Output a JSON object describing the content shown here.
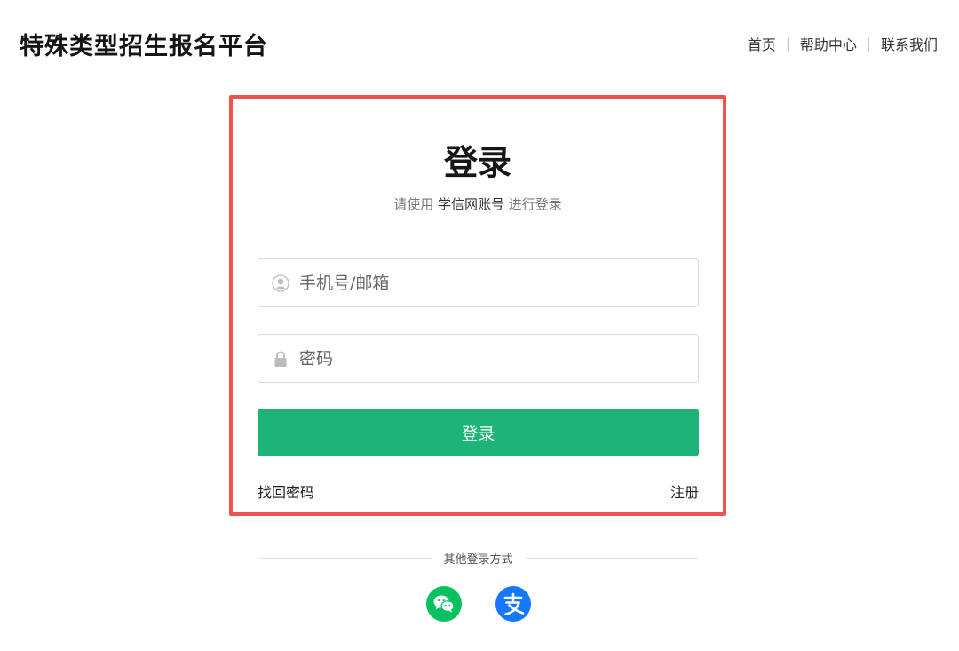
{
  "header": {
    "title": "特殊类型招生报名平台",
    "nav": [
      {
        "label": "首页"
      },
      {
        "label": "帮助中心"
      },
      {
        "label": "联系我们"
      }
    ],
    "separator": "|"
  },
  "login": {
    "title": "登录",
    "subtitle_prefix": "请使用",
    "subtitle_account": "学信网账号",
    "subtitle_suffix": "进行登录",
    "username": {
      "placeholder": "手机号/邮箱",
      "value": "",
      "icon": "user-icon"
    },
    "password": {
      "placeholder": "密码",
      "value": "",
      "icon": "lock-icon"
    },
    "submit_label": "登录",
    "forgot_label": "找回密码",
    "register_label": "注册"
  },
  "other_login": {
    "label": "其他登录方式",
    "providers": [
      {
        "name": "wechat",
        "icon": "wechat-icon",
        "color": "#07c160"
      },
      {
        "name": "alipay",
        "icon": "alipay-icon",
        "color": "#1677ff"
      }
    ]
  },
  "colors": {
    "accent_green": "#1eb378",
    "highlight_border": "#ef5350"
  }
}
